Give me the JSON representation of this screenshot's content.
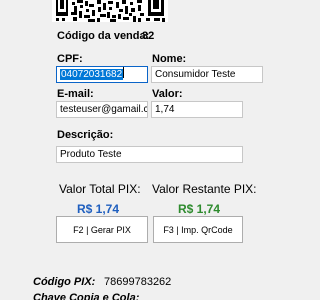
{
  "sale": {
    "code_label": "Código da venda:",
    "code_value": "32"
  },
  "form": {
    "cpf_label": "CPF:",
    "cpf_value": "04072031682",
    "nome_label": "Nome:",
    "nome_value": "Consumidor Teste",
    "email_label": "E-mail:",
    "email_value": "testeuser@gamail.com",
    "valor_label": "Valor:",
    "valor_value": "1,74",
    "descricao_label": "Descrição:",
    "descricao_value": "Produto Teste"
  },
  "pix": {
    "total_label": "Valor Total PIX:",
    "total_value": "R$ 1,74",
    "total_color": "#1f5fbf",
    "restante_label": "Valor Restante PIX:",
    "restante_value": "R$ 1,74",
    "restante_color": "#2e8b2e"
  },
  "buttons": {
    "gerar_pix": "F2 | Gerar PIX",
    "imp_qrcode": "F3 | Imp. QrCode"
  },
  "footer": {
    "codigo_pix_label": "Código PIX:",
    "codigo_pix_value": "78699783262",
    "chave_label": "Chave Copia e Cola:"
  }
}
